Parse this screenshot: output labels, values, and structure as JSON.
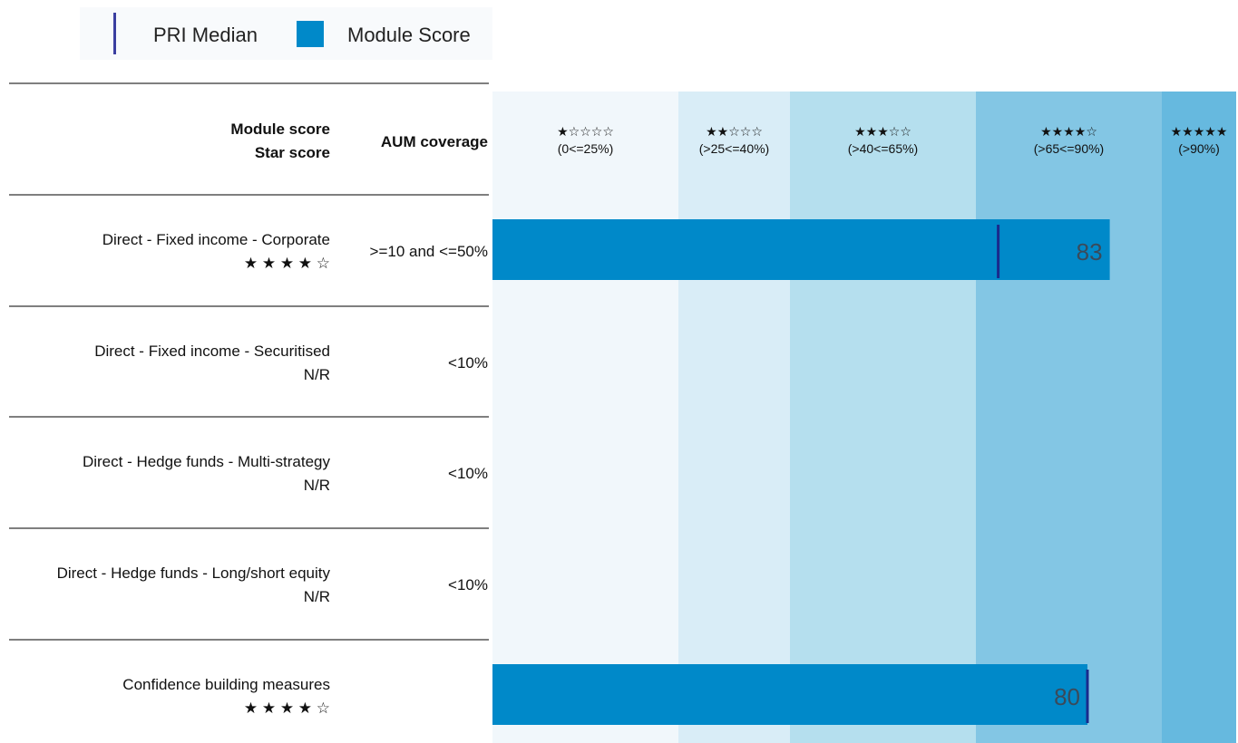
{
  "legend": {
    "median_label": "PRI Median",
    "score_label": "Module Score"
  },
  "header": {
    "module_score": "Module score",
    "star_score": "Star score",
    "aum_coverage": "AUM coverage"
  },
  "colors": {
    "bar": "#0089c9",
    "median": "#1a2a8c",
    "bands": [
      "#f1f7fb",
      "#d9edf7",
      "#b5dfee",
      "#83c6e4",
      "#66b9df"
    ]
  },
  "chart_data": {
    "type": "bar",
    "orientation": "horizontal",
    "xlim": [
      0,
      100
    ],
    "bands": [
      {
        "stars": "★☆☆☆☆",
        "range": "(0<=25%)",
        "from": 0,
        "to": 25
      },
      {
        "stars": "★★☆☆☆",
        "range": "(>25<=40%)",
        "from": 25,
        "to": 40
      },
      {
        "stars": "★★★☆☆",
        "range": "(>40<=65%)",
        "from": 40,
        "to": 65
      },
      {
        "stars": "★★★★☆",
        "range": "(>65<=90%)",
        "from": 65,
        "to": 90
      },
      {
        "stars": "★★★★★",
        "range": "(>90%)",
        "from": 90,
        "to": 100
      }
    ],
    "rows": [
      {
        "name": "Direct - Fixed income - Corporate",
        "stars": "★ ★ ★ ★ ☆",
        "aum": ">=10 and <=50%",
        "score": 83,
        "score_label": "83",
        "median": 68
      },
      {
        "name": "Direct - Fixed income - Securitised",
        "stars": "N/R",
        "aum": "<10%",
        "score": null,
        "score_label": "",
        "median": null
      },
      {
        "name": "Direct - Hedge funds - Multi-strategy",
        "stars": "N/R",
        "aum": "<10%",
        "score": null,
        "score_label": "",
        "median": null
      },
      {
        "name": "Direct - Hedge funds - Long/short equity",
        "stars": "N/R",
        "aum": "<10%",
        "score": null,
        "score_label": "",
        "median": null
      },
      {
        "name": "Confidence building measures",
        "stars": "★ ★ ★ ★ ☆",
        "aum": "",
        "score": 80,
        "score_label": "80",
        "median": 80
      }
    ]
  }
}
